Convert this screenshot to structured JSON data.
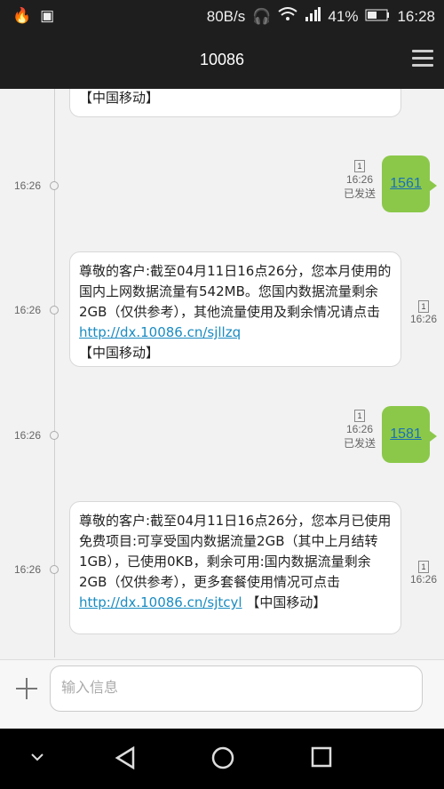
{
  "status_bar": {
    "speed": "80B/s",
    "battery": "41%",
    "time": "16:28"
  },
  "header": {
    "title": "10086"
  },
  "messages": {
    "top_fragment": "【中国移动】",
    "out1": {
      "time_left": "16:26",
      "text": "1561",
      "time": "16:26",
      "status": "已发送"
    },
    "in1": {
      "time_left": "16:26",
      "text": "尊敬的客户:截至04月11日16点26分，您本月使用的国内上网数据流量有542MB。您国内数据流量剩余2GB（仅供参考），其他流量使用及剩余情况请点击 ",
      "link": "http://dx.10086.cn/sjllzq",
      "suffix": "【中国移动】",
      "time": "16:26"
    },
    "out2": {
      "time_left": "16:26",
      "text": "1581",
      "time": "16:26",
      "status": "已发送"
    },
    "in2": {
      "time_left": "16:26",
      "text": "尊敬的客户:截至04月11日16点26分，您本月已使用免费项目:可享受国内数据流量2GB（其中上月结转1GB），已使用0KB，剩余可用:国内数据流量剩余2GB（仅供参考），更多套餐使用情况可点击 ",
      "link": "http://dx.10086.cn/sjtcyl",
      "suffix": " 【中国移动】",
      "time": "16:26"
    }
  },
  "input": {
    "placeholder": "输入信息"
  },
  "sim_label": "1"
}
